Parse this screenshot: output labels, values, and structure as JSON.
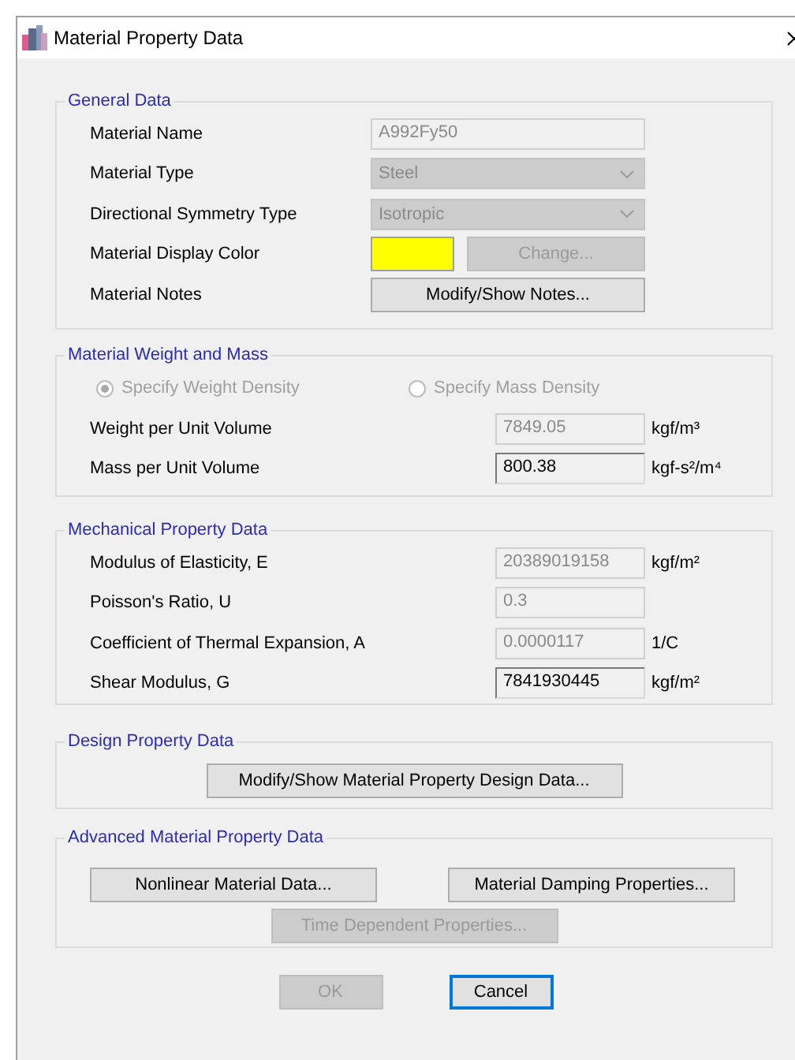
{
  "window": {
    "title": "Material Property Data"
  },
  "general": {
    "title": "General Data",
    "fields": [
      {
        "kind": "text",
        "label": "Material Name",
        "value": "A992Fy50",
        "disabled": true
      },
      {
        "kind": "dropdown",
        "label": "Material Type",
        "value": "Steel",
        "disabled": true
      },
      {
        "kind": "dropdown",
        "label": "Directional Symmetry Type",
        "value": "Isotropic",
        "disabled": true
      },
      {
        "kind": "color",
        "label": "Material Display Color",
        "color": "#ffff00",
        "button": "Change...",
        "disabled": true
      },
      {
        "kind": "button",
        "label": "Material Notes",
        "button": "Modify/Show Notes...",
        "disabled": false
      }
    ]
  },
  "weight": {
    "title": "Material Weight and Mass",
    "options": [
      {
        "label": "Specify Weight Density",
        "selected": true,
        "disabled": true
      },
      {
        "label": "Specify Mass Density",
        "selected": false,
        "disabled": true
      }
    ],
    "fields": [
      {
        "label": "Weight per Unit Volume",
        "value": "7849.05",
        "unit": "kgf/m³",
        "disabled": true
      },
      {
        "label": "Mass per Unit Volume",
        "value": "800.38",
        "unit": "kgf-s²/m⁴",
        "disabled": false
      }
    ]
  },
  "mechanical": {
    "title": "Mechanical Property Data",
    "fields": [
      {
        "label": "Modulus of Elasticity,  E",
        "value": "20389019158",
        "unit": "kgf/m²",
        "disabled": true
      },
      {
        "label": "Poisson's Ratio,  U",
        "value": "0.3",
        "disabled": true
      },
      {
        "label": "Coefficient of Thermal Expansion,  A",
        "value": "0.0000117",
        "unit": "1/C",
        "disabled": true
      },
      {
        "label": "Shear Modulus,  G",
        "value": "7841930445",
        "unit": "kgf/m²",
        "disabled": false
      }
    ]
  },
  "design": {
    "title": "Design Property Data",
    "button": {
      "label": "Modify/Show Material Property Design Data...",
      "disabled": false
    }
  },
  "advanced": {
    "title": "Advanced Material Property Data",
    "buttons": [
      {
        "label": "Nonlinear Material Data...",
        "disabled": false
      },
      {
        "label": "Material Damping Properties...",
        "disabled": false
      },
      {
        "label": "Time Dependent Properties...",
        "disabled": true
      }
    ]
  },
  "buttons": [
    {
      "label": "OK",
      "disabled": true,
      "default": false
    },
    {
      "label": "Cancel",
      "disabled": false,
      "default": true
    }
  ]
}
